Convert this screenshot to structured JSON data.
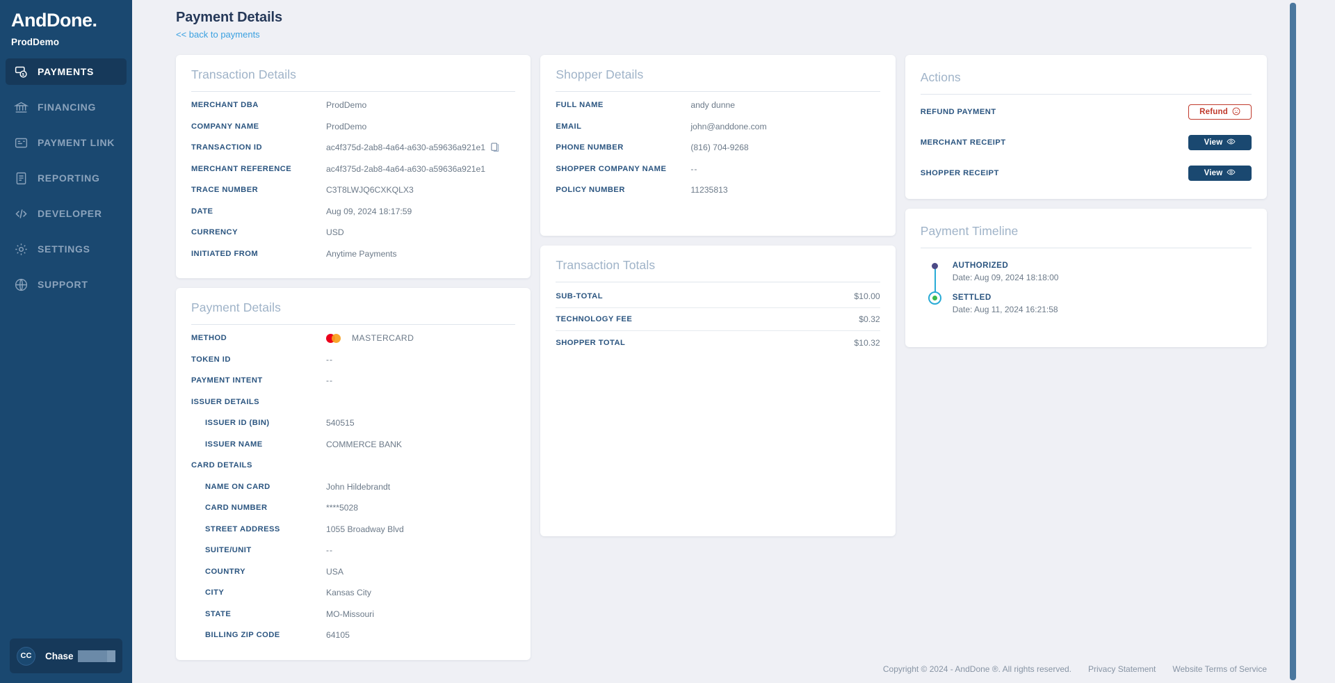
{
  "sidebar": {
    "brand": "AndDone",
    "brand_dot": ".",
    "tenant": "ProdDemo",
    "items": [
      {
        "label": "PAYMENTS",
        "icon": "payments-icon",
        "active": true
      },
      {
        "label": "FINANCING",
        "icon": "bank-icon",
        "active": false
      },
      {
        "label": "PAYMENT LINK",
        "icon": "payment-link-icon",
        "active": false
      },
      {
        "label": "REPORTING",
        "icon": "report-icon",
        "active": false
      },
      {
        "label": "DEVELOPER",
        "icon": "code-icon",
        "active": false
      },
      {
        "label": "SETTINGS",
        "icon": "gear-icon",
        "active": false
      },
      {
        "label": "SUPPORT",
        "icon": "globe-icon",
        "active": false
      }
    ],
    "account": {
      "initials": "CC",
      "name": "Chase"
    }
  },
  "header": {
    "title": "Payment Details",
    "back_link": "<< back to payments"
  },
  "transaction_details": {
    "title": "Transaction Details",
    "rows": [
      {
        "label": "MERCHANT DBA",
        "value": "ProdDemo"
      },
      {
        "label": "COMPANY NAME",
        "value": "ProdDemo"
      },
      {
        "label": "TRANSACTION ID",
        "value": "ac4f375d-2ab8-4a64-a630-a59636a921e1"
      },
      {
        "label": "MERCHANT REFERENCE",
        "value": "ac4f375d-2ab8-4a64-a630-a59636a921e1"
      },
      {
        "label": "TRACE NUMBER",
        "value": "C3T8LWJQ6CXKQLX3"
      },
      {
        "label": "DATE",
        "value": "Aug 09, 2024 18:17:59"
      },
      {
        "label": "CURRENCY",
        "value": "USD"
      },
      {
        "label": "INITIATED FROM",
        "value": "Anytime Payments"
      }
    ]
  },
  "payment_details": {
    "title": "Payment Details",
    "method_label": "METHOD",
    "method_value": "MASTERCARD",
    "rows": [
      {
        "label": "TOKEN ID",
        "value": "--",
        "indent": false
      },
      {
        "label": "PAYMENT INTENT",
        "value": "--",
        "indent": false
      },
      {
        "label": "ISSUER DETAILS",
        "value": "",
        "indent": false
      },
      {
        "label": "ISSUER ID (BIN)",
        "value": "540515",
        "indent": true
      },
      {
        "label": "ISSUER NAME",
        "value": "COMMERCE BANK",
        "indent": true
      },
      {
        "label": "CARD DETAILS",
        "value": "",
        "indent": false
      },
      {
        "label": "NAME ON CARD",
        "value": "John Hildebrandt",
        "indent": true
      },
      {
        "label": "CARD NUMBER",
        "value": "****5028",
        "indent": true
      },
      {
        "label": "STREET ADDRESS",
        "value": "1055 Broadway Blvd",
        "indent": true
      },
      {
        "label": "SUITE/UNIT",
        "value": "--",
        "indent": true
      },
      {
        "label": "COUNTRY",
        "value": "USA",
        "indent": true
      },
      {
        "label": "CITY",
        "value": "Kansas City",
        "indent": true
      },
      {
        "label": "STATE",
        "value": "MO-Missouri",
        "indent": true
      },
      {
        "label": "BILLING ZIP CODE",
        "value": "64105",
        "indent": true
      }
    ]
  },
  "shopper_details": {
    "title": "Shopper Details",
    "rows": [
      {
        "label": "FULL NAME",
        "value": "andy dunne"
      },
      {
        "label": "EMAIL",
        "value": "john@anddone.com"
      },
      {
        "label": "PHONE NUMBER",
        "value": "(816) 704-9268"
      },
      {
        "label": "SHOPPER COMPANY NAME",
        "value": "--"
      },
      {
        "label": "POLICY NUMBER",
        "value": "11235813"
      }
    ]
  },
  "transaction_totals": {
    "title": "Transaction Totals",
    "rows": [
      {
        "label": "SUB-TOTAL",
        "value": "$10.00"
      },
      {
        "label": "TECHNOLOGY FEE",
        "value": "$0.32"
      },
      {
        "label": "SHOPPER TOTAL",
        "value": "$10.32"
      }
    ]
  },
  "actions": {
    "title": "Actions",
    "rows": [
      {
        "label": "REFUND PAYMENT",
        "button": "Refund",
        "style": "refund",
        "icon": "sad-face-icon"
      },
      {
        "label": "MERCHANT RECEIPT",
        "button": "View",
        "style": "view",
        "icon": "eye-icon"
      },
      {
        "label": "SHOPPER RECEIPT",
        "button": "View",
        "style": "view",
        "icon": "eye-icon"
      }
    ]
  },
  "payment_timeline": {
    "title": "Payment Timeline",
    "events": [
      {
        "status": "AUTHORIZED",
        "date": "Date: Aug 09, 2024 18:18:00",
        "marker": "plain",
        "color": "#4c4a86"
      },
      {
        "status": "SETTLED",
        "date": "Date: Aug 11, 2024 16:21:58",
        "marker": "ring",
        "color": "#3aba4d"
      }
    ]
  },
  "footer": {
    "copyright": "Copyright © 2024 - AndDone ®. All rights reserved.",
    "privacy": "Privacy Statement",
    "terms": "Website Terms of Service"
  },
  "colors": {
    "sidebar_bg": "#1a4870",
    "page_bg": "#eff0f5",
    "accent_link": "#3aa0e0",
    "label": "#2b5580",
    "value": "#6c7a89",
    "refund_red": "#c0392b",
    "timeline_line": "#29abd6"
  }
}
